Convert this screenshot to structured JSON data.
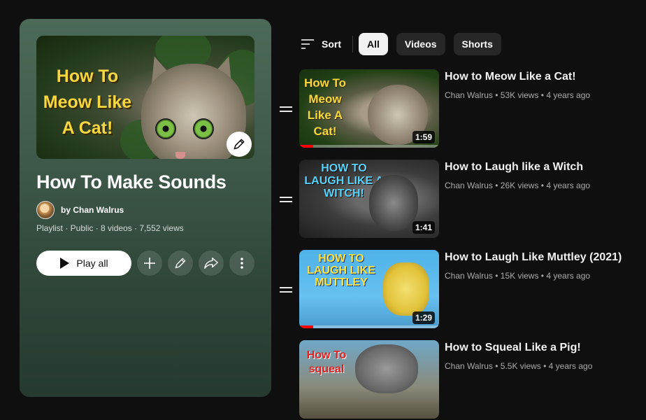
{
  "panel": {
    "hero_text": "How To Meow Like A Cat!",
    "title": "How To Make Sounds",
    "owner": "by Chan Walrus",
    "meta": "Playlist · Public · 8 videos · 7,552 views",
    "play_all": "Play all"
  },
  "filters": {
    "sort_label": "Sort",
    "chips": [
      "All",
      "Videos",
      "Shorts"
    ]
  },
  "videos": [
    {
      "title": "How to Meow Like a Cat!",
      "meta": "Chan Walrus • 53K views • 4 years ago",
      "duration": "1:59",
      "thumb_text": "How To Meow Like A Cat!",
      "progress": 0.1
    },
    {
      "title": "How to Laugh like a Witch",
      "meta": "Chan Walrus • 26K views • 4 years ago",
      "duration": "1:41",
      "thumb_text": "HOW TO LAUGH LIKE A WITCH!",
      "progress": 0.0
    },
    {
      "title": "How to Laugh Like Muttley (2021)",
      "meta": "Chan Walrus • 15K views • 4 years ago",
      "duration": "1:29",
      "thumb_text": "HOW TO LAUGH LIKE MUTTLEY",
      "progress": 0.1
    },
    {
      "title": "How to Squeal Like a Pig!",
      "meta": "Chan Walrus • 5.5K views • 4 years ago",
      "duration": "",
      "thumb_text": "How To squeal",
      "progress": 0.0
    }
  ],
  "colors": {
    "accent_red": "#ff0000",
    "cat_text": "#f5d742"
  }
}
